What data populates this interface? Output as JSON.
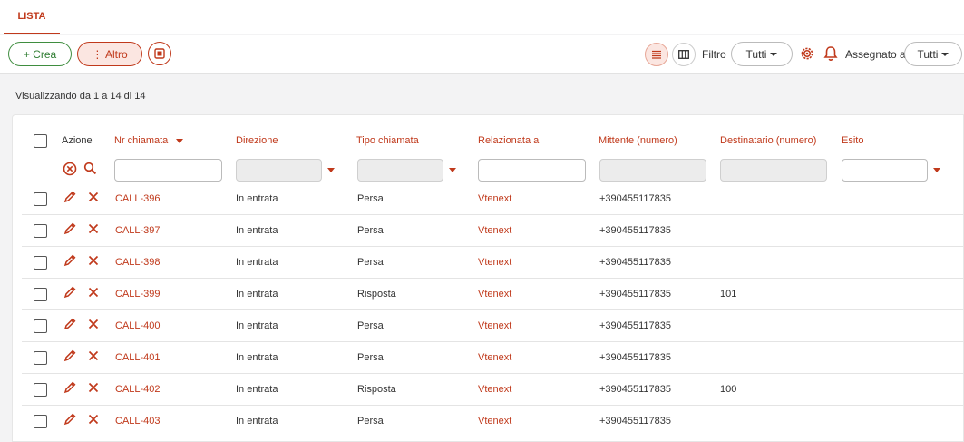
{
  "tabs": [
    {
      "label": "LISTA",
      "active": true
    }
  ],
  "toolbar": {
    "crea_label": "+ Crea",
    "altro_label": "⋮ Altro",
    "filtro_label": "Filtro",
    "filtro_value": "Tutti",
    "assegnato_label": "Assegnato a",
    "assegnato_value": "Tutti"
  },
  "info": "Visualizzando da 1 a 14 di 14",
  "columns": {
    "azione": "Azione",
    "nr": "Nr chiamata",
    "direzione": "Direzione",
    "tipo": "Tipo chiamata",
    "relazionata": "Relazionata a",
    "mittente": "Mittente (numero)",
    "destinatario": "Destinatario (numero)",
    "esito": "Esito"
  },
  "rows": [
    {
      "nr": "CALL-396",
      "direzione": "In entrata",
      "tipo": "Persa",
      "relazionata": "Vtenext",
      "mittente": "+390455117835",
      "destinatario": ""
    },
    {
      "nr": "CALL-397",
      "direzione": "In entrata",
      "tipo": "Persa",
      "relazionata": "Vtenext",
      "mittente": "+390455117835",
      "destinatario": ""
    },
    {
      "nr": "CALL-398",
      "direzione": "In entrata",
      "tipo": "Persa",
      "relazionata": "Vtenext",
      "mittente": "+390455117835",
      "destinatario": ""
    },
    {
      "nr": "CALL-399",
      "direzione": "In entrata",
      "tipo": "Risposta",
      "relazionata": "Vtenext",
      "mittente": "+390455117835",
      "destinatario": "101"
    },
    {
      "nr": "CALL-400",
      "direzione": "In entrata",
      "tipo": "Persa",
      "relazionata": "Vtenext",
      "mittente": "+390455117835",
      "destinatario": ""
    },
    {
      "nr": "CALL-401",
      "direzione": "In entrata",
      "tipo": "Persa",
      "relazionata": "Vtenext",
      "mittente": "+390455117835",
      "destinatario": ""
    },
    {
      "nr": "CALL-402",
      "direzione": "In entrata",
      "tipo": "Risposta",
      "relazionata": "Vtenext",
      "mittente": "+390455117835",
      "destinatario": "100"
    },
    {
      "nr": "CALL-403",
      "direzione": "In entrata",
      "tipo": "Persa",
      "relazionata": "Vtenext",
      "mittente": "+390455117835",
      "destinatario": ""
    }
  ],
  "colors": {
    "accent": "#c0391b",
    "green": "#2f7d32"
  }
}
